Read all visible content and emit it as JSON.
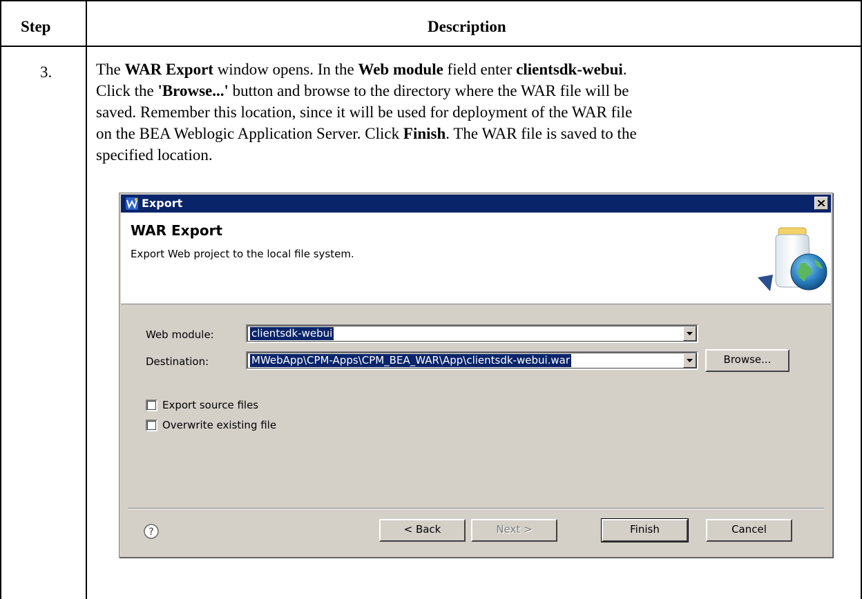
{
  "table": {
    "header_step": "Step",
    "header_description": "Description",
    "step_number": "3.",
    "description": {
      "lines": [
        [
          {
            "t": "The ",
            "b": false
          },
          {
            "t": "WAR Export",
            "b": true
          },
          {
            "t": " window opens. In the ",
            "b": false
          },
          {
            "t": "Web module",
            "b": true
          },
          {
            "t": " field enter ",
            "b": false
          },
          {
            "t": "clientsdk-webui",
            "b": true
          },
          {
            "t": ".",
            "b": false
          }
        ],
        [
          {
            "t": "Click the ",
            "b": false
          },
          {
            "t": "'Browse...'",
            "b": true
          },
          {
            "t": " button and browse to the directory where the WAR file will be",
            "b": false
          }
        ],
        [
          {
            "t": "saved. Remember this location, since it will be used for deployment of the WAR file",
            "b": false
          }
        ],
        [
          {
            "t": "on the BEA Weblogic Application Server. Click ",
            "b": false
          },
          {
            "t": "Finish",
            "b": true
          },
          {
            "t": ". The WAR file is saved to the",
            "b": false
          }
        ],
        [
          {
            "t": "specified location.",
            "b": false
          }
        ]
      ]
    }
  },
  "dialog": {
    "window_title": "Export",
    "banner_title": "WAR Export",
    "banner_subtitle": "Export Web project to the local file system.",
    "web_module_label": "Web module:",
    "web_module_value": "clientsdk-webui",
    "destination_label": "Destination:",
    "destination_value": "MWebApp\\CPM-Apps\\CPM_BEA_WAR\\App\\clientsdk-webui.war",
    "browse_label": "Browse...",
    "export_source_label": "Export source files",
    "export_source_checked": false,
    "overwrite_label": "Overwrite existing file",
    "overwrite_checked": false,
    "back_label": "< Back",
    "next_label": "Next >",
    "finish_label": "Finish",
    "cancel_label": "Cancel",
    "icons": [
      "app-icon",
      "close-icon",
      "jar-globe-icon",
      "combo-arrow-icon",
      "help-icon"
    ],
    "colors": {
      "titlebar": "#0a246a",
      "dialog_face": "#d4d0c8",
      "selection": "#0a246a"
    }
  }
}
